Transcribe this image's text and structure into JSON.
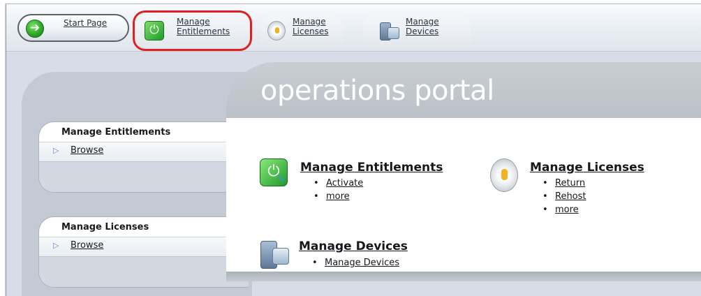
{
  "nav": {
    "start_page": "Start Page",
    "manage_entitlements": [
      "Manage",
      "Entitlements"
    ],
    "manage_licenses": [
      "Manage",
      "Licenses"
    ],
    "manage_devices": [
      "Manage",
      "Devices"
    ]
  },
  "portal": {
    "title": "operations portal"
  },
  "sidebar": {
    "entitlements": {
      "heading": "Manage Entitlements",
      "link": "Browse"
    },
    "licenses": {
      "heading": "Manage Licenses",
      "link": "Browse"
    }
  },
  "sections": {
    "entitlements": {
      "title": "Manage Entitlements",
      "items": [
        "Activate",
        "more"
      ]
    },
    "licenses": {
      "title": "Manage Licenses",
      "items": [
        "Return",
        "Rehost",
        "more"
      ]
    },
    "devices": {
      "title": "Manage Devices",
      "items": [
        "Manage Devices"
      ]
    }
  },
  "colors": {
    "highlight": "#e02020",
    "accent_green": "#2fa82a"
  },
  "icons": [
    "arrow-right-icon",
    "power-icon",
    "license-icon",
    "devices-icon",
    "bullet-arrow-icon"
  ]
}
